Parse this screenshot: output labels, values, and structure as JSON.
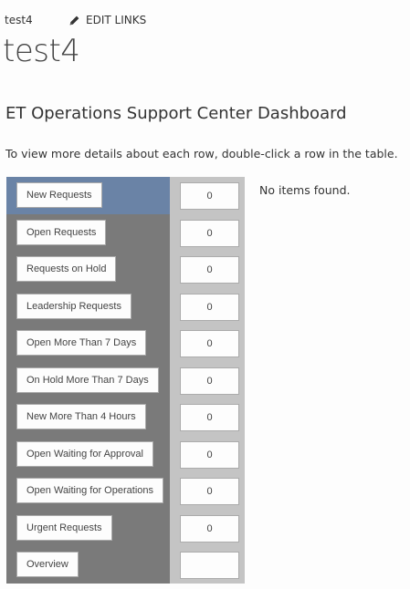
{
  "header": {
    "site_link": "test4",
    "edit_links": "EDIT LINKS",
    "page_title": "test4"
  },
  "dashboard": {
    "title": "ET Operations Support Center Dashboard",
    "instructions": "To view more details about each row, double-click a row in the table.",
    "empty_message": "No items found.",
    "selected_row": "New Requests",
    "rows": [
      {
        "label": "New Requests",
        "count": "0"
      },
      {
        "label": "Open Requests",
        "count": "0"
      },
      {
        "label": "Requests on Hold",
        "count": "0"
      },
      {
        "label": "Leadership Requests",
        "count": "0"
      },
      {
        "label": "Open More Than 7 Days",
        "count": "0"
      },
      {
        "label": "On Hold More Than 7 Days",
        "count": "0"
      },
      {
        "label": "New More Than 4 Hours",
        "count": "0"
      },
      {
        "label": "Open Waiting for Approval",
        "count": "0"
      },
      {
        "label": "Open Waiting for Operations",
        "count": "0"
      },
      {
        "label": "Urgent Requests",
        "count": "0"
      },
      {
        "label": "Overview",
        "count": ""
      }
    ]
  },
  "colors": {
    "selected_row": "#6a83a6",
    "left_column": "#7a7a7a",
    "right_column": "#c4c4c4"
  }
}
